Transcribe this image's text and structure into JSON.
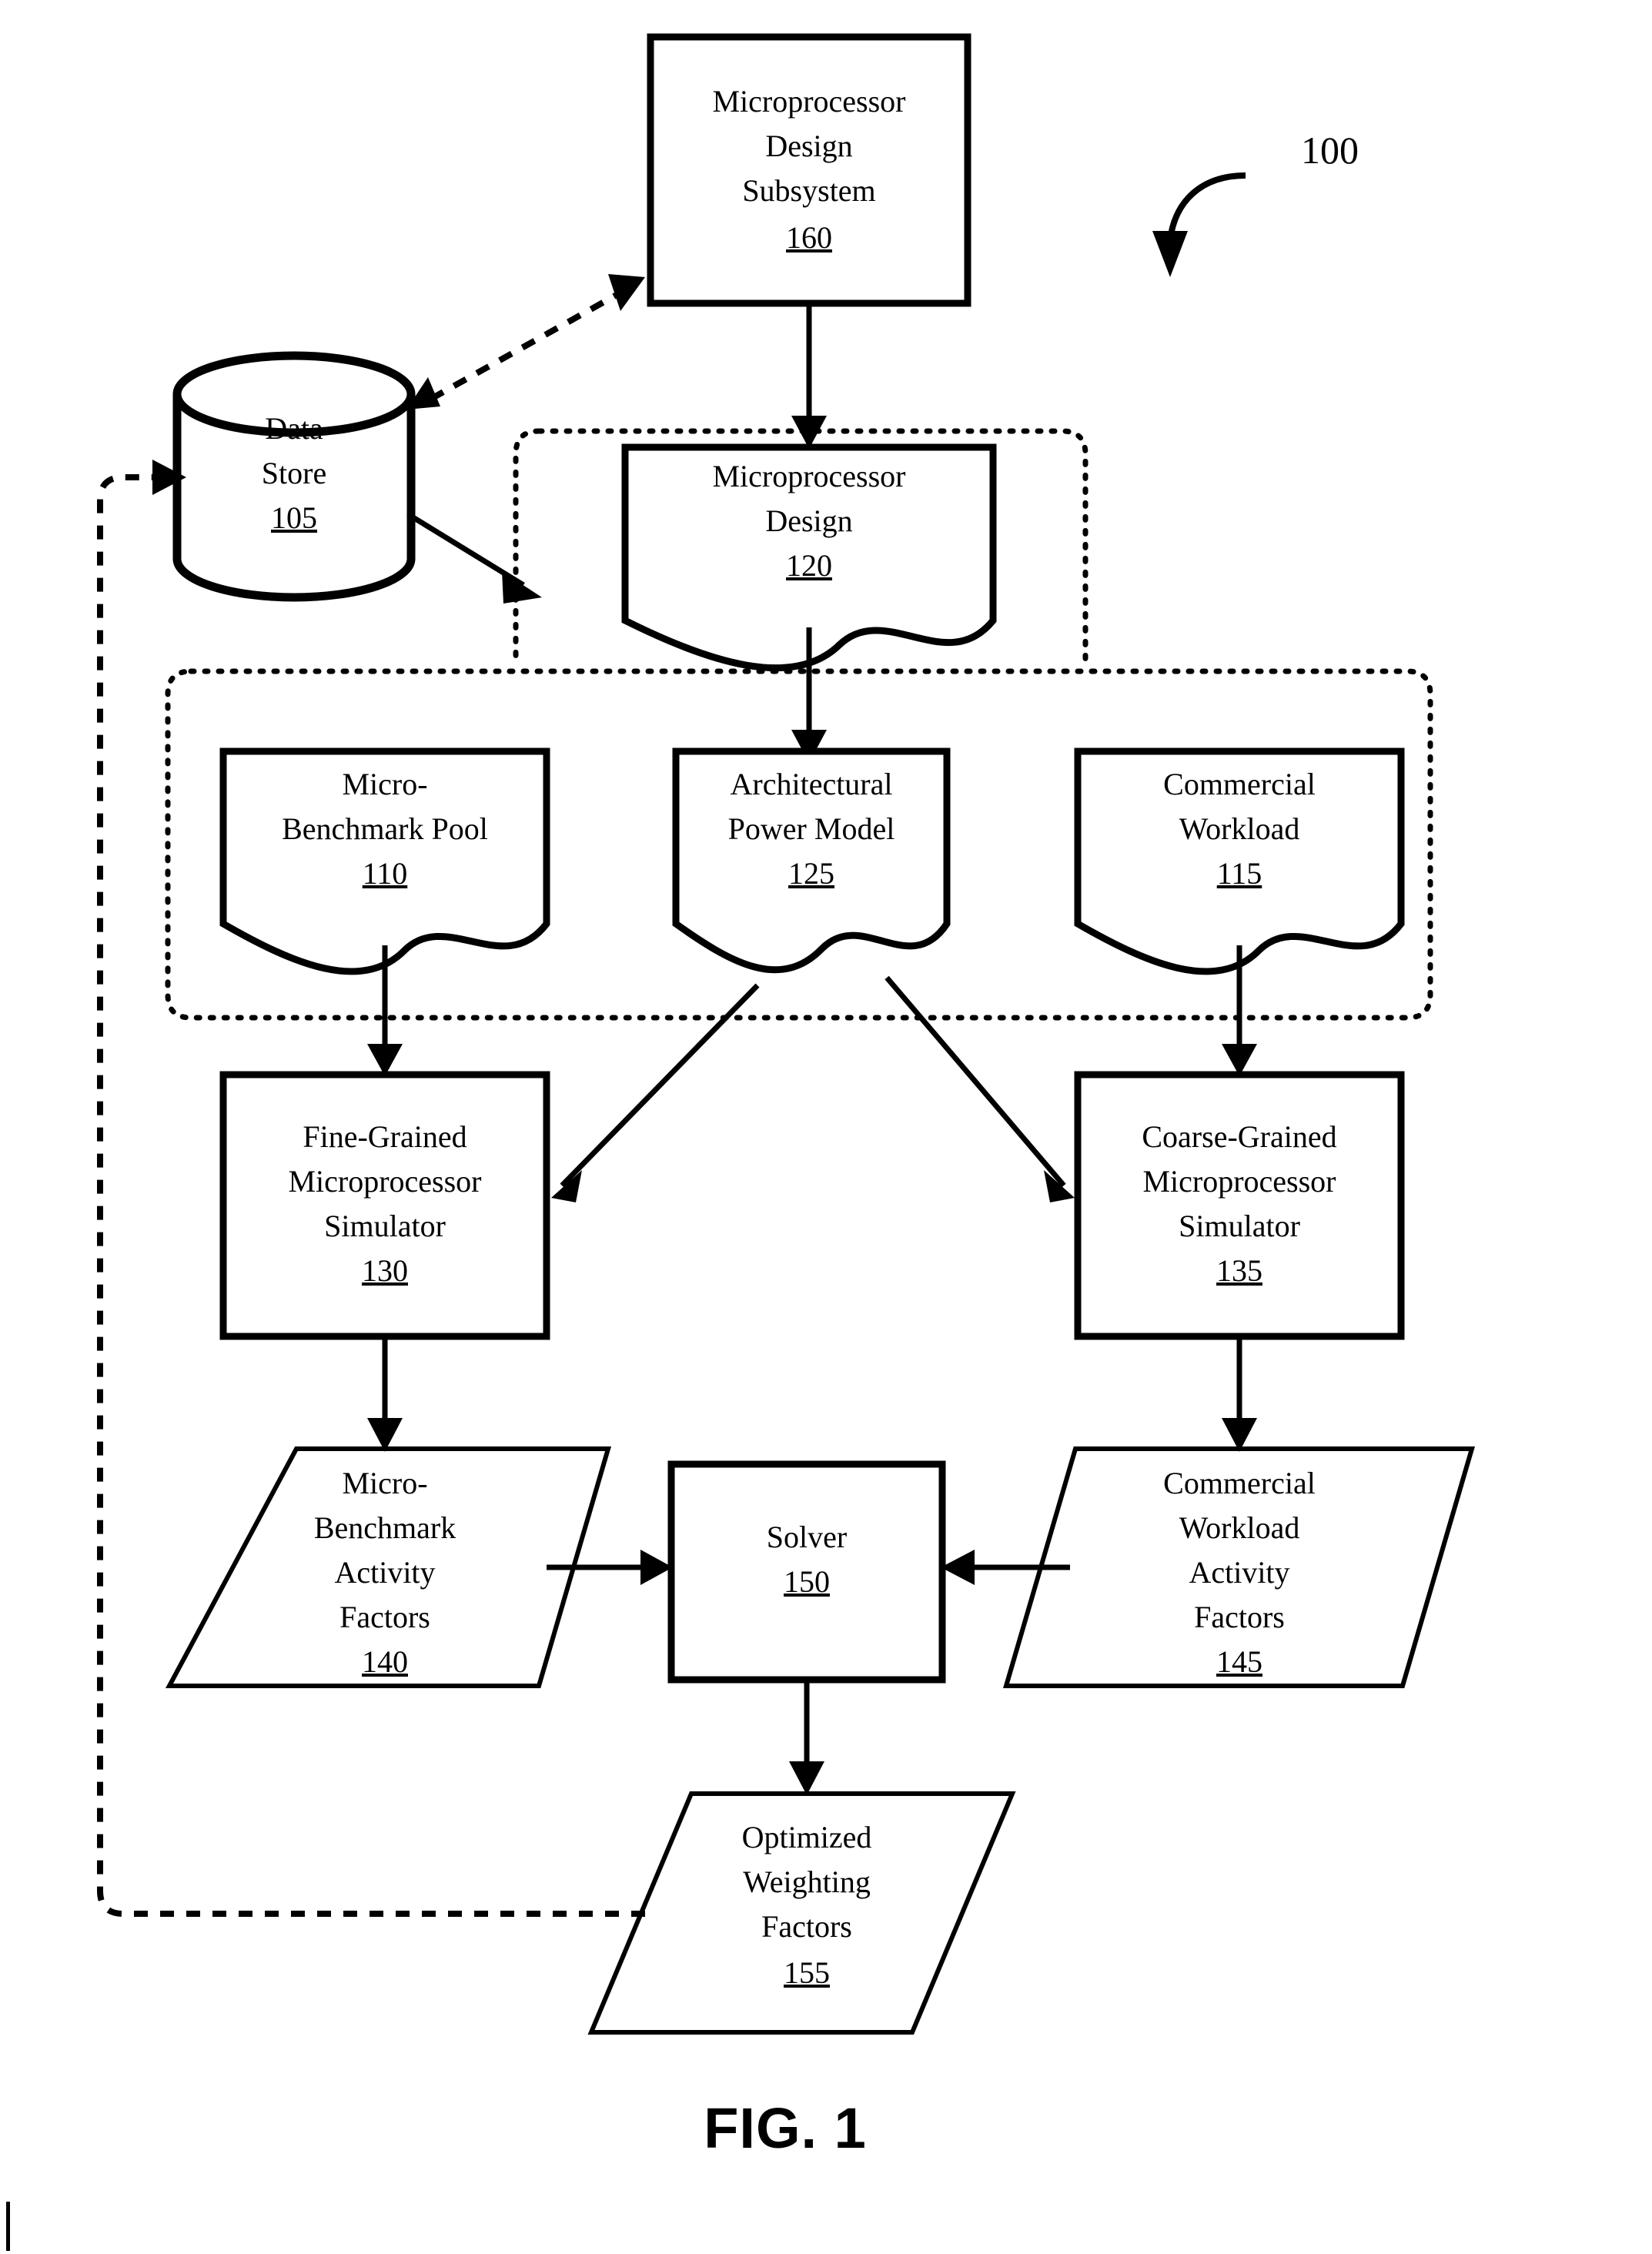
{
  "figure": {
    "caption": "FIG. 1",
    "system_reference": "100"
  },
  "nodes": {
    "design_subsystem": {
      "lines": [
        "Microprocessor",
        "Design",
        "Subsystem"
      ],
      "ref": "160",
      "shape": "rectangle"
    },
    "data_store": {
      "lines": [
        "Data",
        "Store"
      ],
      "ref": "105",
      "shape": "cylinder"
    },
    "microprocessor_design": {
      "lines": [
        "Microprocessor",
        "Design"
      ],
      "ref": "120",
      "shape": "document"
    },
    "micro_benchmark_pool": {
      "lines": [
        "Micro-",
        "Benchmark Pool"
      ],
      "ref": "110",
      "shape": "document"
    },
    "architectural_power_model": {
      "lines": [
        "Architectural",
        "Power Model"
      ],
      "ref": "125",
      "shape": "document"
    },
    "commercial_workload": {
      "lines": [
        "Commercial",
        "Workload"
      ],
      "ref": "115",
      "shape": "document"
    },
    "fine_grained_simulator": {
      "lines": [
        "Fine-Grained",
        "Microprocessor",
        "Simulator"
      ],
      "ref": "130",
      "shape": "rectangle"
    },
    "coarse_grained_simulator": {
      "lines": [
        "Coarse-Grained",
        "Microprocessor",
        "Simulator"
      ],
      "ref": "135",
      "shape": "rectangle"
    },
    "micro_benchmark_activity_factors": {
      "lines": [
        "Micro-",
        "Benchmark",
        "Activity",
        "Factors"
      ],
      "ref": "140",
      "shape": "parallelogram"
    },
    "solver": {
      "lines": [
        "Solver"
      ],
      "ref": "150",
      "shape": "rectangle"
    },
    "commercial_workload_activity_factors": {
      "lines": [
        "Commercial",
        "Workload",
        "Activity",
        "Factors"
      ],
      "ref": "145",
      "shape": "parallelogram"
    },
    "optimized_weighting_factors": {
      "lines": [
        "Optimized",
        "Weighting",
        "Factors"
      ],
      "ref": "155",
      "shape": "parallelogram"
    }
  },
  "colors": {
    "stroke": "#000000",
    "fill": "#ffffff",
    "background": "#ffffff"
  }
}
